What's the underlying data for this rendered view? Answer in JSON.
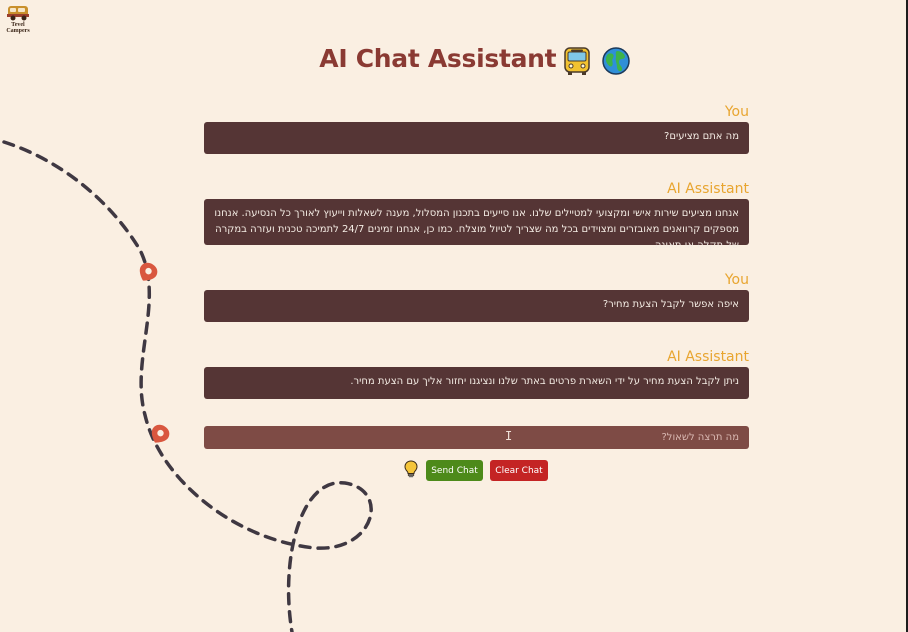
{
  "header": {
    "logo_text": "Tevel Campers",
    "title": "AI Chat Assistant",
    "title_icons": [
      "bus-icon",
      "globe-icon"
    ]
  },
  "messages": [
    {
      "sender": "You",
      "text": "מה אתם מציעים?"
    },
    {
      "sender": "AI Assistant",
      "text": "אנחנו מציעים שירות אישי ומקצועי למטיילים שלנו. אנו סייעים בתכנון המסלול, מענה לשאלות וייעוץ לאורך כל הנסיעה. אנחנו מספקים קרוואנים מאובזרים ומצוידים בכל מה שצריך לטיול מוצלח. כמו כן, אנחנו זמינים 24/7 לתמיכה טכנית ועזרה במקרה של תקלה או תאונה."
    },
    {
      "sender": "You",
      "text": "איפה אפשר לקבל הצעת מחיר?"
    },
    {
      "sender": "AI Assistant",
      "text": "ניתן לקבל הצעת מחיר על ידי השארת פרטים באתר שלנו ונציגנו יחזור אליך עם הצעת מחיר."
    }
  ],
  "input": {
    "placeholder": "מה תרצה לשאול?",
    "value": ""
  },
  "actions": {
    "send_label": "Send Chat",
    "clear_label": "Clear Chat",
    "hint_icon": "lightbulb-icon"
  },
  "colors": {
    "background": "#faefe2",
    "title": "#8a3a33",
    "sender": "#e8a530",
    "bubble": "#553535",
    "input": "#7e4b45",
    "send_button": "#4d8a1a",
    "clear_button": "#c42424"
  }
}
